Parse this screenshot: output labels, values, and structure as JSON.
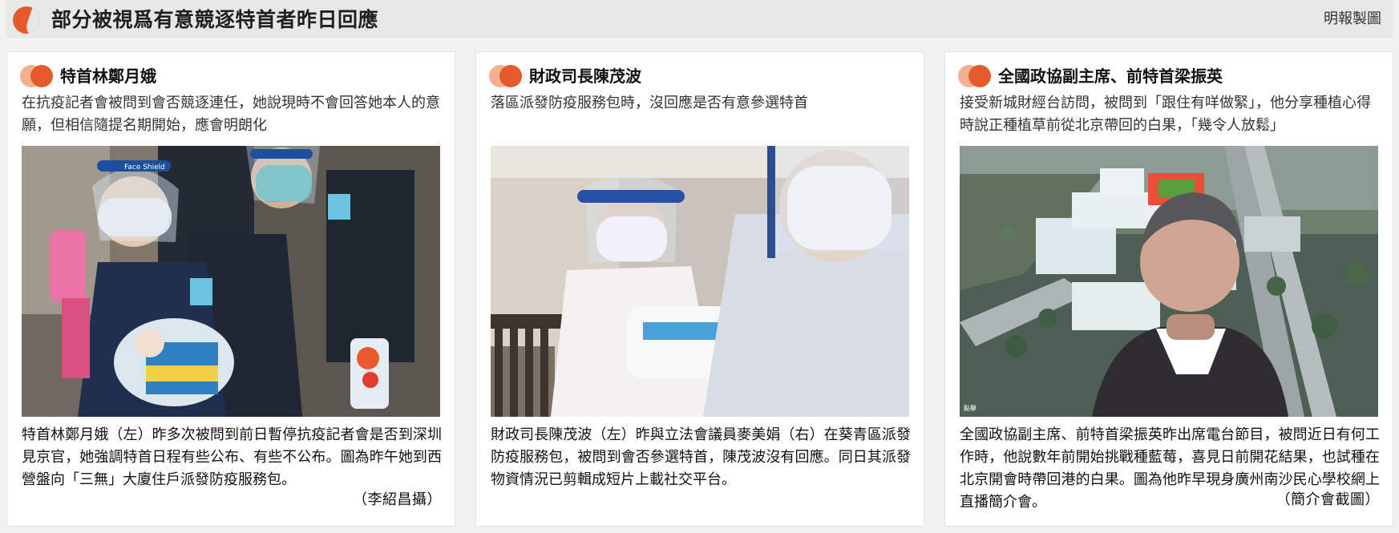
{
  "header": {
    "title": "部分被視爲有意競逐特首者昨日回應",
    "credit": "明報製圖"
  },
  "cards": [
    {
      "name": "特首林鄭月娥",
      "summary": "在抗疫記者會被問到會否競逐連任，她說現時不會回答她本人的意願，但相信隨提名期開始，應會明朗化",
      "caption": "特首林鄭月娥（左）昨多次被問到前日暫停抗疫記者會是否到深圳見京官，她強調特首日程有些公布、有些不公布。圖為昨午她到西營盤向「三無」大廈住戶派發防疫服務包。",
      "credit": "（李紹昌攝）",
      "photo_text": "Face Shield"
    },
    {
      "name": "財政司長陳茂波",
      "summary": "落區派發防疫服務包時，沒回應是否有意參選特首",
      "caption": "財政司長陳茂波（左）昨與立法會議員麥美娟（右）在葵青區派發防疫服務包，被問到會否參選特首，陳茂波沒有回應。同日其派發物資情況已剪輯成短片上載社交平台。",
      "credit": "",
      "photo_text": ""
    },
    {
      "name": "全國政協副主席、前特首梁振英",
      "summary": "接受新城財經台訪問，被問到「跟住有咩做緊」，他分享種植心得時說正種植草前從北京帶回的白果，「幾令人放鬆」",
      "caption": "全國政協副主席、前特首梁振英昨出席電台節目，被問近日有何工作時，他說數年前開始挑戰種藍莓，喜見日前開花結果，也試種在北京開會時帶回港的白果。圖為他昨早現身廣州南沙民心學校網上直播簡介會。",
      "credit": "（簡介會截圖）",
      "photo_text": "點擊"
    }
  ]
}
